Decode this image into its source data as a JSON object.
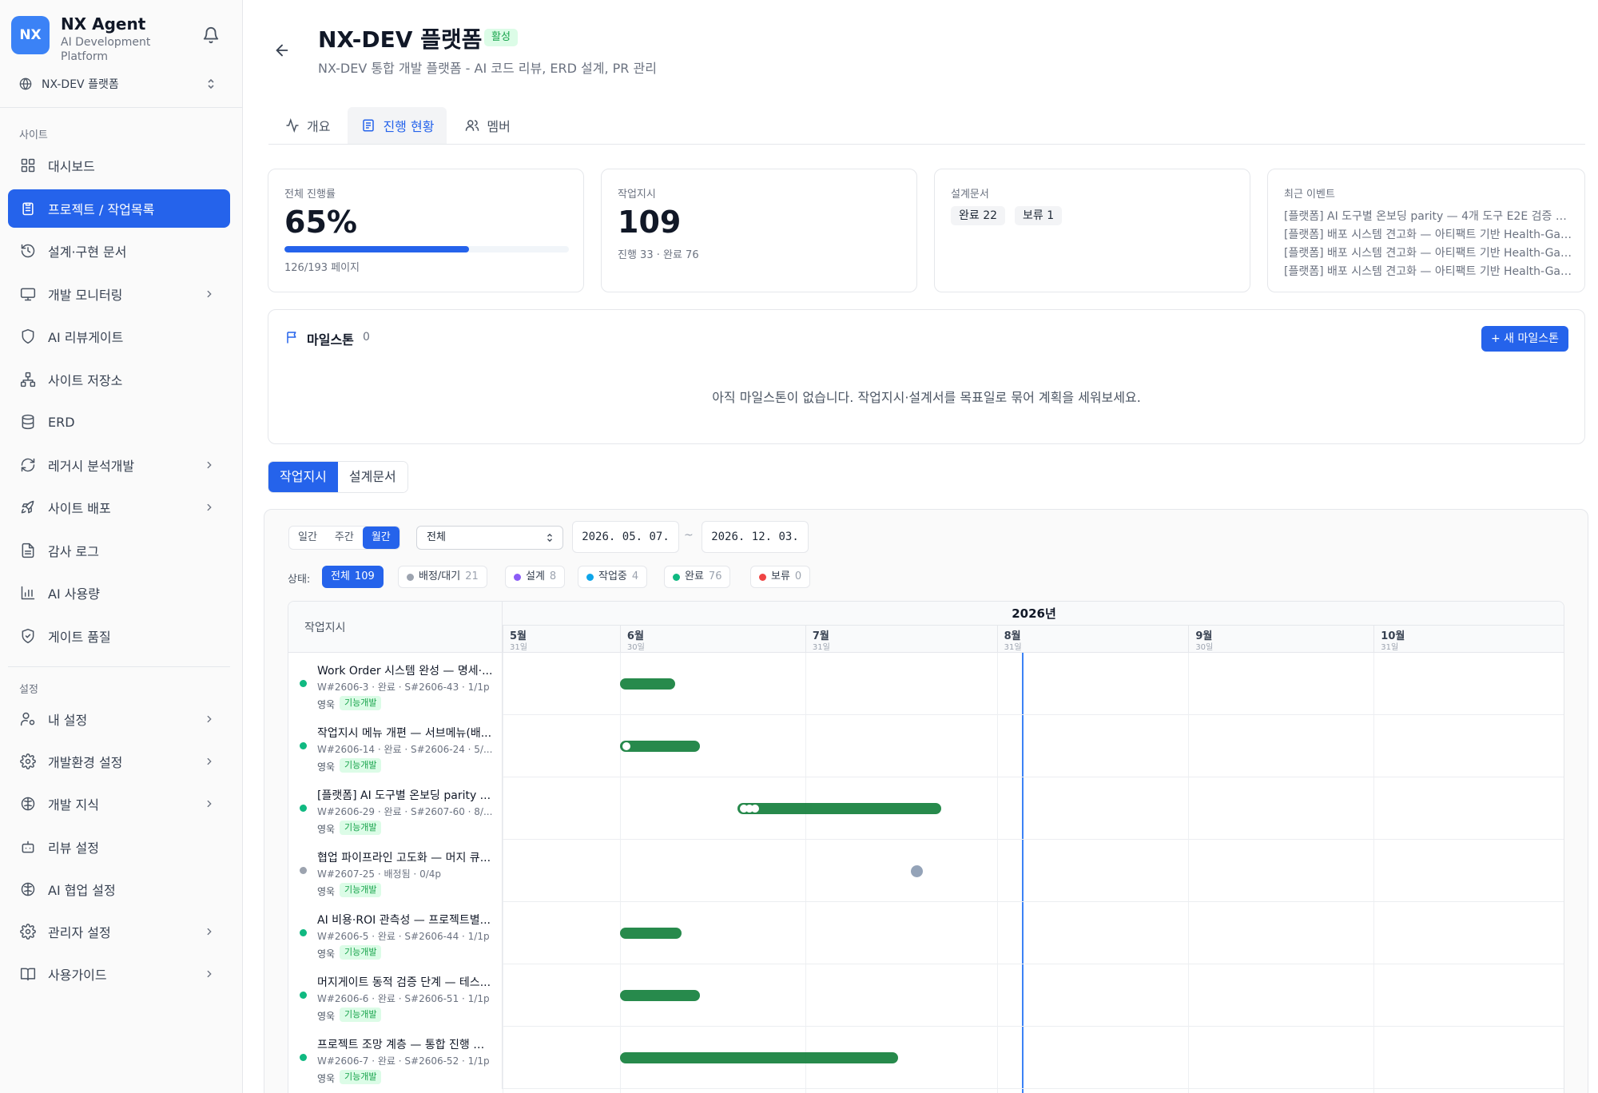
{
  "sidebar": {
    "logo_text": "NX",
    "app_name": "NX Agent",
    "app_sub": "AI Development Platform",
    "site_name": "NX-DEV 플랫폼",
    "section_site": "사이트",
    "section_settings": "설정",
    "items": [
      {
        "label": "대시보드",
        "icon": "dashboard-icon"
      },
      {
        "label": "프로젝트 / 작업목록",
        "icon": "clipboard-icon",
        "active": true
      },
      {
        "label": "설계·구현 문서",
        "icon": "history-icon"
      },
      {
        "label": "개발 모니터링",
        "icon": "monitor-icon",
        "chevron": true
      },
      {
        "label": "AI 리뷰게이트",
        "icon": "shield-icon"
      },
      {
        "label": "사이트 저장소",
        "icon": "repo-icon"
      },
      {
        "label": "ERD",
        "icon": "database-icon"
      },
      {
        "label": "레거시 분석개발",
        "icon": "refresh-icon",
        "chevron": true
      },
      {
        "label": "사이트 배포",
        "icon": "rocket-icon",
        "chevron": true
      },
      {
        "label": "감사 로그",
        "icon": "document-icon"
      },
      {
        "label": "AI 사용량",
        "icon": "bar-chart-icon"
      },
      {
        "label": "게이트 품질",
        "icon": "shield-check-icon"
      }
    ],
    "settings_items": [
      {
        "label": "내 설정",
        "icon": "user-gear-icon",
        "chevron": true
      },
      {
        "label": "개발환경 설정",
        "icon": "gear-icon",
        "chevron": true
      },
      {
        "label": "개발 지식",
        "icon": "brain-icon",
        "chevron": true
      },
      {
        "label": "리뷰 설정",
        "icon": "bot-icon"
      },
      {
        "label": "AI 협업 설정",
        "icon": "brain-icon"
      },
      {
        "label": "관리자 설정",
        "icon": "gear-icon",
        "chevron": true
      },
      {
        "label": "사용가이드",
        "icon": "book-icon",
        "chevron": true
      }
    ]
  },
  "header": {
    "title": "NX-DEV 플랫폼",
    "status": "활성",
    "subtitle": "NX-DEV 통합 개발 플랫폼 - AI 코드 리뷰, ERD 설계, PR 관리",
    "tabs": [
      {
        "label": "개요",
        "icon": "activity-icon"
      },
      {
        "label": "진행 현황",
        "icon": "list-icon",
        "active": true
      },
      {
        "label": "멤버",
        "icon": "users-icon"
      }
    ]
  },
  "stats": {
    "progress_label": "전체 진행률",
    "progress_value": "65%",
    "progress_fraction": 0.65,
    "progress_foot": "126/193 페이지",
    "work_label": "작업지시",
    "work_value": "109",
    "work_foot": "진행 33 · 완료 76",
    "design_label": "설계문서",
    "design_done": "완료 22",
    "design_hold": "보류 1",
    "events_label": "최근 이벤트",
    "events": [
      "[플랫폼] AI 도구별 온보딩 parity — 4개 도구 E2E 검증 + ...",
      "[플랫폼] 배포 시스템 견고화 — 아티팩트 기반 Health-Gat...",
      "[플랫폼] 배포 시스템 견고화 — 아티팩트 기반 Health-Gat...",
      "[플랫폼] 배포 시스템 견고화 — 아티팩트 기반 Health-Gat..."
    ]
  },
  "milestone": {
    "title": "마일스톤",
    "count": "0",
    "new_button": "+ 새 마일스톤",
    "empty": "아직 마일스톤이 없습니다. 작업지시·설계서를 목표일로 묶어 계획을 세워보세요."
  },
  "content_tabs": [
    "작업지시",
    "설계문서"
  ],
  "filters": {
    "views": [
      "일간",
      "주간",
      "월간"
    ],
    "active_view": "월간",
    "select_value": "전체",
    "date_from": "2026. 05. 07.",
    "date_sep": "~",
    "date_to": "2026. 12. 03.",
    "status_label": "상태:",
    "chips": [
      {
        "label": "전체",
        "count": "109",
        "active": true
      },
      {
        "label": "배정/대기",
        "count": "21",
        "color": "#9ca3af"
      },
      {
        "label": "설계",
        "count": "8",
        "color": "#8b5cf6"
      },
      {
        "label": "작업중",
        "count": "4",
        "color": "#0ea5e9"
      },
      {
        "label": "완료",
        "count": "76",
        "color": "#10b981"
      },
      {
        "label": "보류",
        "count": "0",
        "color": "#ef4444"
      }
    ]
  },
  "gantt": {
    "left_header": "작업지시",
    "year": "2026년",
    "months": [
      {
        "name": "5월",
        "days": "31일"
      },
      {
        "name": "6월",
        "days": "30일"
      },
      {
        "name": "7월",
        "days": "31일"
      },
      {
        "name": "8월",
        "days": "31일"
      },
      {
        "name": "9월",
        "days": "30일"
      },
      {
        "name": "10월",
        "days": "31일"
      }
    ],
    "rows": [
      {
        "title": "Work Order 시스템 완성 — 명세·...",
        "meta": "W#2606-3 · 완료 · S#2606-43 · 1/1p",
        "owner": "영욱",
        "tag": "기능개발",
        "status_color": "#10b981",
        "kind": "bar",
        "start": "2026-06-01",
        "end": "2026-06-10",
        "knobs": 0
      },
      {
        "title": "작업지시 메뉴 개편 — 서브메뉴(배...",
        "meta": "W#2606-14 · 완료 · S#2606-24 · 5/...",
        "owner": "영욱",
        "tag": "기능개발",
        "status_color": "#10b981",
        "kind": "bar",
        "start": "2026-06-01",
        "end": "2026-06-14",
        "knobs": 1
      },
      {
        "title": "[플랫폼] AI 도구별 온보딩 parity ...",
        "meta": "W#2606-29 · 완료 · S#2607-60 · 8/...",
        "owner": "영욱",
        "tag": "기능개발",
        "status_color": "#10b981",
        "kind": "bar",
        "start": "2026-06-20",
        "end": "2026-07-23",
        "knobs": 3
      },
      {
        "title": "협업 파이프라인 고도화 — 머지 큐...",
        "meta": "W#2607-25 · 배정됨 · 0/4p",
        "owner": "영욱",
        "tag": "기능개발",
        "status_color": "#9ca3af",
        "kind": "point",
        "start": "2026-07-19",
        "end": "2026-07-19",
        "knobs": 0
      },
      {
        "title": "AI 비용·ROI 관측성 — 프로젝트별...",
        "meta": "W#2606-5 · 완료 · S#2606-44 · 1/1p",
        "owner": "영욱",
        "tag": "기능개발",
        "status_color": "#10b981",
        "kind": "bar",
        "start": "2026-06-01",
        "end": "2026-06-11",
        "knobs": 0
      },
      {
        "title": "머지게이트 동적 검증 단계 — 테스...",
        "meta": "W#2606-6 · 완료 · S#2606-51 · 1/1p",
        "owner": "영욱",
        "tag": "기능개발",
        "status_color": "#10b981",
        "kind": "bar",
        "start": "2026-06-01",
        "end": "2026-06-14",
        "knobs": 0
      },
      {
        "title": "프로젝트 조망 계층 — 통합 진행 대...",
        "meta": "W#2606-7 · 완료 · S#2606-52 · 1/1p",
        "owner": "영욱",
        "tag": "기능개발",
        "status_color": "#10b981",
        "kind": "bar",
        "start": "2026-06-01",
        "end": "2026-07-16",
        "knobs": 0
      }
    ],
    "today": "2026-08-05",
    "range_start": "2026-05-13",
    "range_end": "2026-11-01"
  }
}
